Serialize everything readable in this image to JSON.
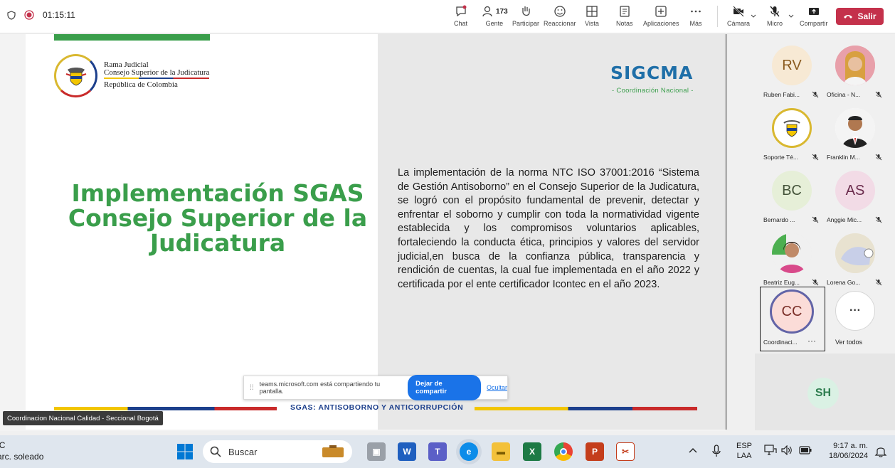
{
  "meeting": {
    "timer": "01:15:11",
    "toolbar": {
      "chat": "Chat",
      "people_count": "173",
      "people": "Gente",
      "raise": "Participar",
      "react": "Reaccionar",
      "view": "Vista",
      "notes": "Notas",
      "apps": "Aplicaciones",
      "more": "Más",
      "camera": "Cámara",
      "mic": "Micro",
      "share": "Compartir",
      "leave": "Salir"
    }
  },
  "slide": {
    "org_lines": [
      "Rama Judicial",
      "Consejo Superior de la Judicatura",
      "República de Colombia"
    ],
    "title_lines": [
      "Implementación SGAS",
      "Consejo Superior de la",
      "Judicatura"
    ],
    "brand": "SIGCMA",
    "brand_sub": "- Coordinación Nacional -",
    "paragraph": "La implementación de la norma NTC ISO 37001:2016 “Sistema de Gestión Antisoborno” en el Consejo Superior de la Judicatura, se logró con el propósito fundamental de prevenir, detectar y enfrentar el soborno y cumplir con toda la normatividad vigente establecida y los compromisos voluntarios aplicables, fortaleciendo la conducta ética, principios y valores del servidor judicial,en busca de la confianza pública, transparencia y rendición de cuentas, la cual fue implementada en el año 2022 y certificada por el ente certificador Icontec en el año 2023.",
    "footer_caption": "SGAS: ANTISOBORNO Y ANTICORRUPCIÓN"
  },
  "share_bar": {
    "message": "teams.microsoft.com está compartiendo tu pantalla.",
    "stop": "Dejar de compartir",
    "hide": "Ocultar"
  },
  "presenter_label": "Coordinacion Nacional Calidad - Seccional Bogotá",
  "participants": [
    {
      "initials": "RV",
      "name": "Ruben Fabi...",
      "color": "#f7e9d4"
    },
    {
      "initials": "",
      "name": "Oficina - N...",
      "color": "#e9b1b8"
    },
    {
      "initials": "",
      "name": "Soporte Té...",
      "color": "#ffffff"
    },
    {
      "initials": "",
      "name": "Franklin M...",
      "color": "#ffffff"
    },
    {
      "initials": "BC",
      "name": "Bernardo ...",
      "color": "#e6efd8"
    },
    {
      "initials": "AS",
      "name": "Anggie Mic...",
      "color": "#f2dbe6"
    },
    {
      "initials": "",
      "name": "Beatriz Eug...",
      "color": "#f0f0f0"
    },
    {
      "initials": "",
      "name": "Lorena Go...",
      "color": "#efe8d7"
    },
    {
      "initials": "CC",
      "name": "Coordinaci...",
      "color": "#fbdcd8"
    },
    {
      "initials": "···",
      "name": "Ver todos",
      "color": "#ffffff"
    }
  ],
  "extra_participant": "SH",
  "taskbar": {
    "weather_temp": "°C",
    "weather_text": "Parc. soleado",
    "search": "Buscar",
    "lang1": "ESP",
    "lang2": "LAA",
    "time": "9:17 a. m.",
    "date": "18/06/2024"
  }
}
